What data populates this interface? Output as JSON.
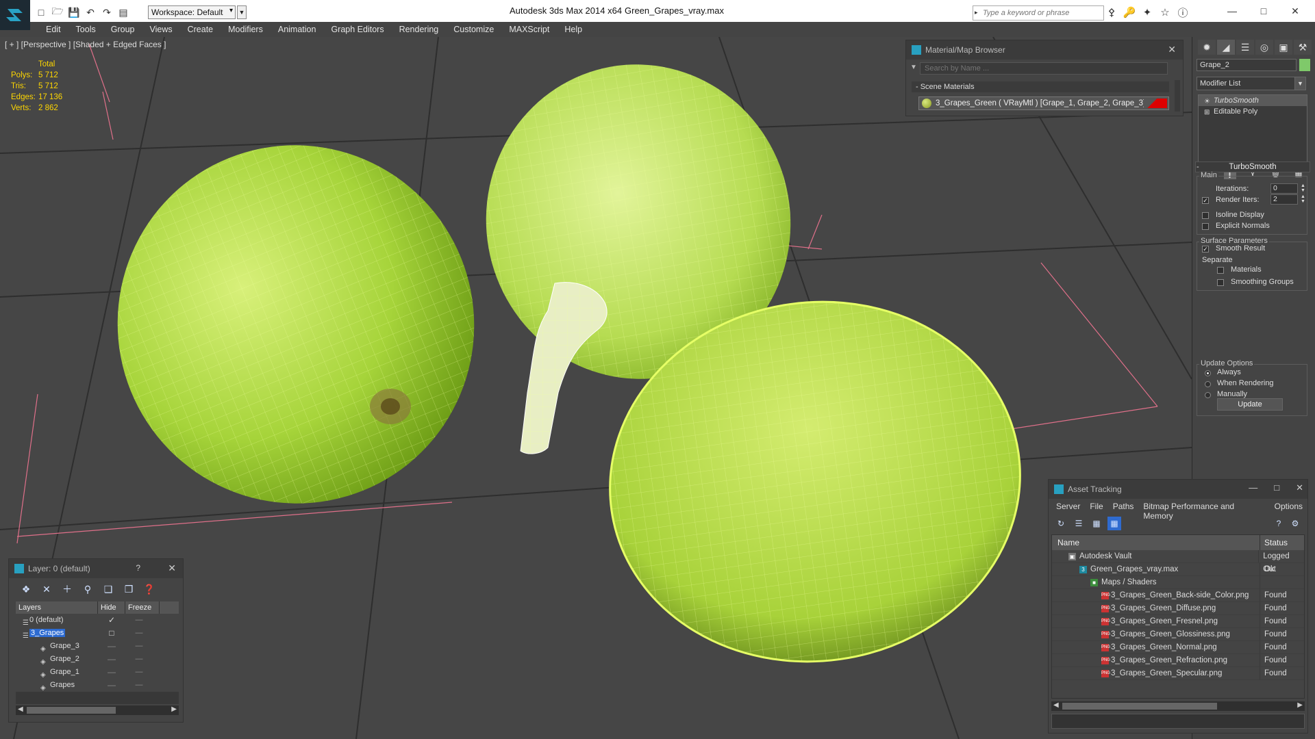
{
  "titlebar": {
    "app_title": "Autodesk 3ds Max  2014 x64",
    "document": "Green_Grapes_vray.max",
    "workspace": "Workspace: Default",
    "search_placeholder": "Type a keyword or phrase"
  },
  "menu": [
    "Edit",
    "Tools",
    "Group",
    "Views",
    "Create",
    "Modifiers",
    "Animation",
    "Graph Editors",
    "Rendering",
    "Customize",
    "MAXScript",
    "Help"
  ],
  "viewport": {
    "label": "[ + ] [Perspective ] [Shaded + Edged Faces ]",
    "stats": {
      "header": "Total",
      "rows": [
        {
          "k": "Polys:",
          "v": "5 712"
        },
        {
          "k": "Tris:",
          "v": "5 712"
        },
        {
          "k": "Edges:",
          "v": "17 136"
        },
        {
          "k": "Verts:",
          "v": "2 862"
        }
      ]
    }
  },
  "material_browser": {
    "title": "Material/Map Browser",
    "search_placeholder": "Search by Name ...",
    "section": "- Scene Materials",
    "material": "3_Grapes_Green  ( VRayMtl )  [Grape_1, Grape_2, Grape_3]"
  },
  "command_panel": {
    "object_name": "Grape_2",
    "modifier_list": "Modifier List",
    "stack": [
      "TurboSmooth",
      "Editable Poly"
    ],
    "turbosmooth": {
      "title": "TurboSmooth",
      "main": "Main",
      "iterations_label": "Iterations:",
      "iterations": "0",
      "render_iters_label": "Render Iters:",
      "render_iters": "2",
      "isoline": "Isoline Display",
      "explicit_normals": "Explicit Normals",
      "surface_params": "Surface Parameters",
      "smooth_result": "Smooth Result",
      "separate": "Separate",
      "materials": "Materials",
      "smoothing_groups": "Smoothing Groups",
      "update_options": "Update Options",
      "always": "Always",
      "when_rendering": "When Rendering",
      "manually": "Manually",
      "update": "Update"
    }
  },
  "layer_panel": {
    "title": "Layer: 0 (default)",
    "columns": [
      "Layers",
      "Hide",
      "Freeze"
    ],
    "rows": [
      "0 (default)",
      "3_Grapes",
      "Grape_3",
      "Grape_2",
      "Grape_1",
      "Grapes"
    ]
  },
  "asset_tracking": {
    "title": "Asset Tracking",
    "menu": [
      "Server",
      "File",
      "Paths",
      "Bitmap Performance and Memory",
      "Options"
    ],
    "columns": [
      "Name",
      "Status"
    ],
    "rows": [
      {
        "name": "Autodesk Vault",
        "status": "Logged Out"
      },
      {
        "name": "Green_Grapes_vray.max",
        "status": "Ok"
      },
      {
        "name": "Maps / Shaders",
        "status": ""
      },
      {
        "name": "3_Grapes_Green_Back-side_Color.png",
        "status": "Found"
      },
      {
        "name": "3_Grapes_Green_Diffuse.png",
        "status": "Found"
      },
      {
        "name": "3_Grapes_Green_Fresnel.png",
        "status": "Found"
      },
      {
        "name": "3_Grapes_Green_Glossiness.png",
        "status": "Found"
      },
      {
        "name": "3_Grapes_Green_Normal.png",
        "status": "Found"
      },
      {
        "name": "3_Grapes_Green_Refraction.png",
        "status": "Found"
      },
      {
        "name": "3_Grapes_Green_Specular.png",
        "status": "Found"
      }
    ]
  }
}
